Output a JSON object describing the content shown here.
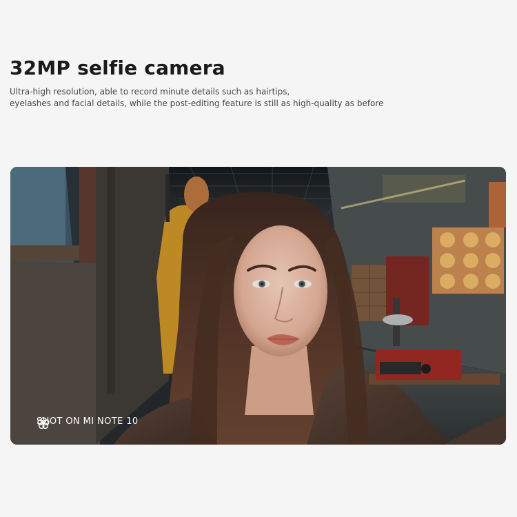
{
  "heading": {
    "title": "32MP selfie camera",
    "description_line1": "Ultra-high resolution, able to record minute details such as hairtips,",
    "description_line2": "eyelashes and facial details, while the post-editing feature is still as high-quality as before"
  },
  "photo": {
    "badge_icon": "mi-camera-logo-icon",
    "badge_text": "SHOT ON MI NOTE 10"
  },
  "colors": {
    "background": "#f5f5f5",
    "title": "#1a1a1a",
    "description": "#444444",
    "badge_text": "#ffffff"
  }
}
